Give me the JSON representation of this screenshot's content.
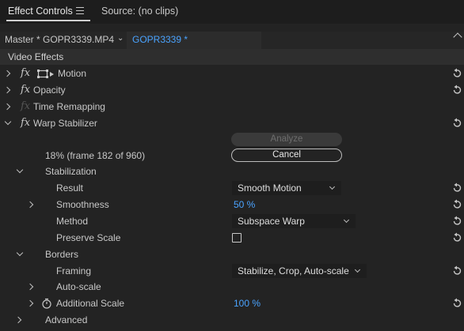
{
  "tabs": {
    "active": "Effect Controls",
    "source": "Source: (no clips)"
  },
  "clip": {
    "master": "Master * GOPR3339.MP4",
    "sequence": "GOPR3339 * GOPR3339.MP4"
  },
  "section_title": "Video Effects",
  "effects": {
    "motion": "Motion",
    "opacity": "Opacity",
    "time_remapping": "Time Remapping",
    "warp_stabilizer": "Warp Stabilizer"
  },
  "fx_symbol": "fx",
  "analysis": {
    "analyze_label": "Analyze",
    "cancel_label": "Cancel",
    "progress_text": "18% (frame 182 of 960)"
  },
  "stabilization": {
    "label": "Stabilization",
    "result_label": "Result",
    "result_value": "Smooth Motion",
    "smoothness_label": "Smoothness",
    "smoothness_value": "50 %",
    "method_label": "Method",
    "method_value": "Subspace Warp",
    "preserve_scale_label": "Preserve Scale",
    "preserve_scale_checked": false
  },
  "borders": {
    "label": "Borders",
    "framing_label": "Framing",
    "framing_value": "Stabilize, Crop, Auto-scale",
    "auto_scale_label": "Auto-scale",
    "additional_scale_label": "Additional Scale",
    "additional_scale_value": "100 %"
  },
  "advanced_label": "Advanced",
  "colors": {
    "accent": "#4aa3ff",
    "panel": "#232323",
    "header": "#2e2e2e"
  }
}
